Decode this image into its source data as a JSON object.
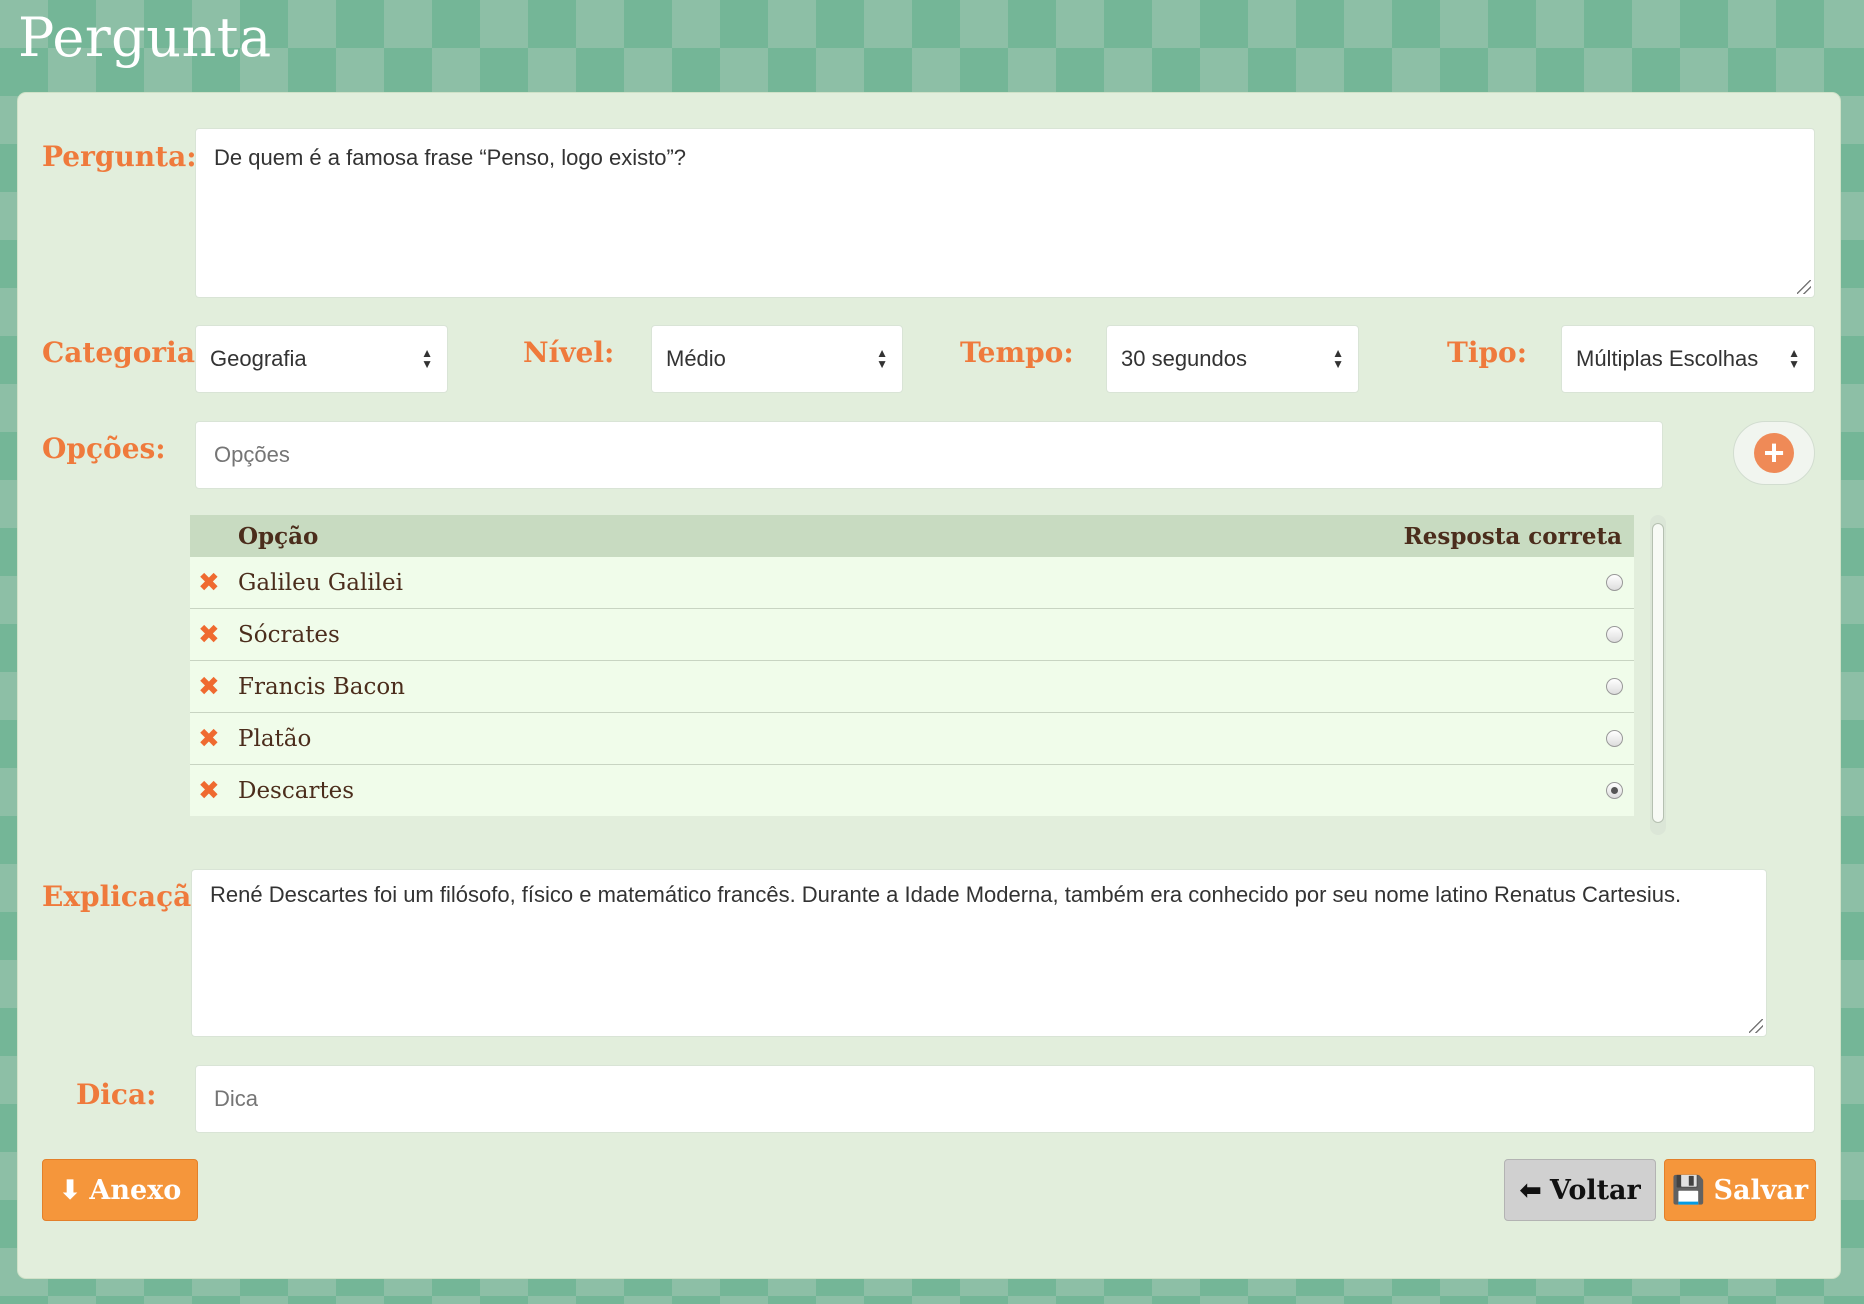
{
  "page": {
    "title": "Pergunta"
  },
  "form": {
    "pergunta_label": "Pergunta:",
    "pergunta_value": "De quem é a famosa frase “Penso, logo existo”?",
    "categoria_label": "Categoria:",
    "categoria_value": "Geografia",
    "nivel_label": "Nível:",
    "nivel_value": "Médio",
    "tempo_label": "Tempo:",
    "tempo_value": "30 segundos",
    "tipo_label": "Tipo:",
    "tipo_value": "Múltiplas Escolhas",
    "opcoes_label": "Opções:",
    "opcoes_placeholder": "Opções",
    "explicacao_label": "Explicação:",
    "explicacao_value": "René Descartes foi um filósofo, físico e matemático francês. Durante a Idade Moderna, também era conhecido por seu nome latino Renatus Cartesius.",
    "dica_label": "Dica:",
    "dica_placeholder": "Dica"
  },
  "options_table": {
    "col_option": "Opção",
    "col_correct": "Resposta correta",
    "rows": [
      {
        "label": "Galileu Galilei",
        "correct": false
      },
      {
        "label": "Sócrates",
        "correct": false
      },
      {
        "label": "Francis Bacon",
        "correct": false
      },
      {
        "label": "Platão",
        "correct": false
      },
      {
        "label": "Descartes",
        "correct": true
      }
    ]
  },
  "buttons": {
    "anexo": "Anexo",
    "voltar": "Voltar",
    "salvar": "Salvar"
  },
  "icons": {
    "remove": "close-icon",
    "add": "plus-circle-icon",
    "anexo": "download-icon",
    "voltar": "arrow-left-icon",
    "salvar": "floppy-disk-icon"
  },
  "colors": {
    "accent": "#ef7a3c",
    "button_orange": "#f5963b",
    "panel": "#e2eedc",
    "table_header": "#c8dbc1",
    "row_bg": "#f0fcea"
  }
}
